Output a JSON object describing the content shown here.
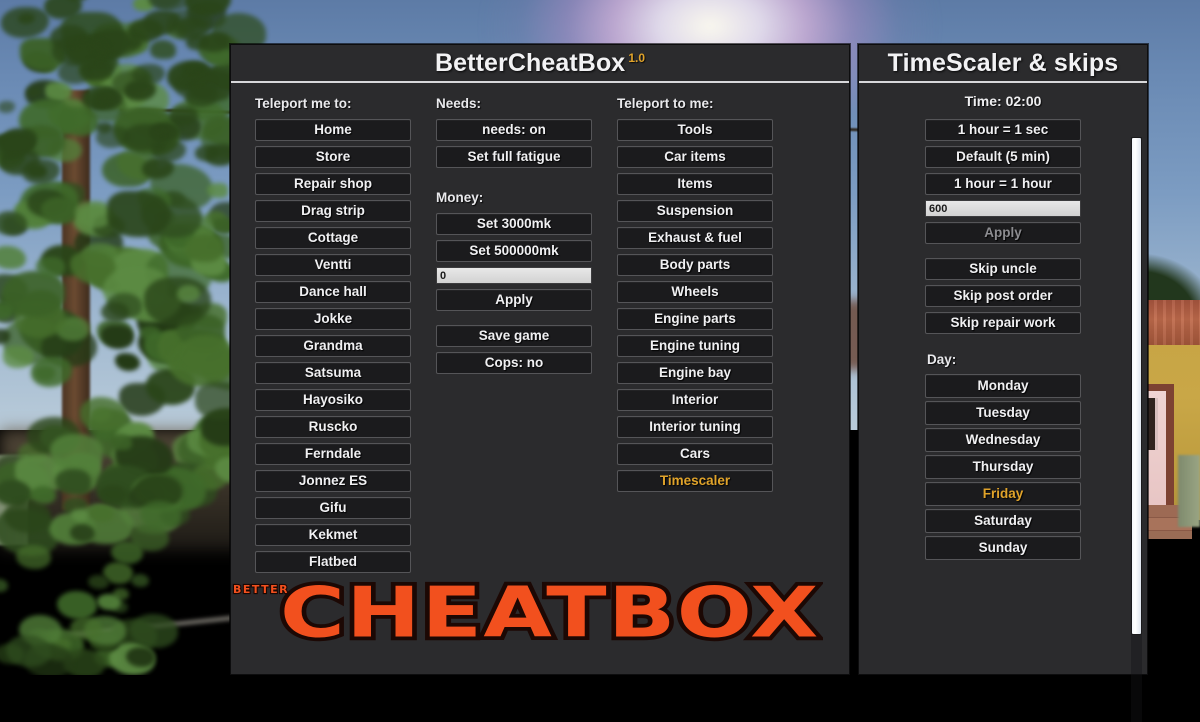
{
  "main_panel": {
    "title": "BetterCheatBox",
    "version": "1.0",
    "teleport_me": {
      "header": "Teleport me to:",
      "buttons": [
        "Home",
        "Store",
        "Repair shop",
        "Drag strip",
        "Cottage",
        "Ventti",
        "Dance hall",
        "Jokke",
        "Grandma",
        "Satsuma",
        "Hayosiko",
        "Ruscko",
        "Ferndale",
        "Jonnez ES",
        "Gifu",
        "Kekmet",
        "Flatbed"
      ]
    },
    "needs": {
      "header": "Needs:",
      "buttons": [
        "needs: on",
        "Set full fatigue"
      ]
    },
    "money": {
      "header": "Money:",
      "buttons": [
        "Set 3000mk",
        "Set 500000mk"
      ],
      "input_value": "0",
      "apply_label": "Apply"
    },
    "misc": {
      "save_label": "Save game",
      "cops_label": "Cops: no"
    },
    "teleport_to_me": {
      "header": "Teleport to me:",
      "buttons": [
        "Tools",
        "Car items",
        "Items",
        "Suspension",
        "Exhaust & fuel",
        "Body parts",
        "Wheels",
        "Engine parts",
        "Engine tuning",
        "Engine bay",
        "Interior",
        "Interior tuning",
        "Cars",
        "Timescaler"
      ],
      "highlighted": "Timescaler"
    }
  },
  "time_panel": {
    "title": "TimeScaler & skips",
    "time_label": "Time: 02:00",
    "scaler_buttons": [
      "1 hour = 1 sec",
      "Default (5 min)",
      "1 hour = 1 hour"
    ],
    "scaler_input_value": "600",
    "apply_label": "Apply",
    "skip_buttons": [
      "Skip uncle",
      "Skip post order",
      "Skip repair work"
    ],
    "day": {
      "header": "Day:",
      "buttons": [
        "Monday",
        "Tuesday",
        "Wednesday",
        "Thursday",
        "Friday",
        "Saturday",
        "Sunday"
      ],
      "highlighted": "Friday"
    }
  },
  "logo": {
    "small_text": "BETTER",
    "main_text": "CHEATBOX"
  },
  "colors": {
    "accent": "#e0a32a",
    "logo_orange": "#f2501e",
    "panel_bg": "#2b2b2d",
    "button_bg": "#1b1b1d"
  }
}
